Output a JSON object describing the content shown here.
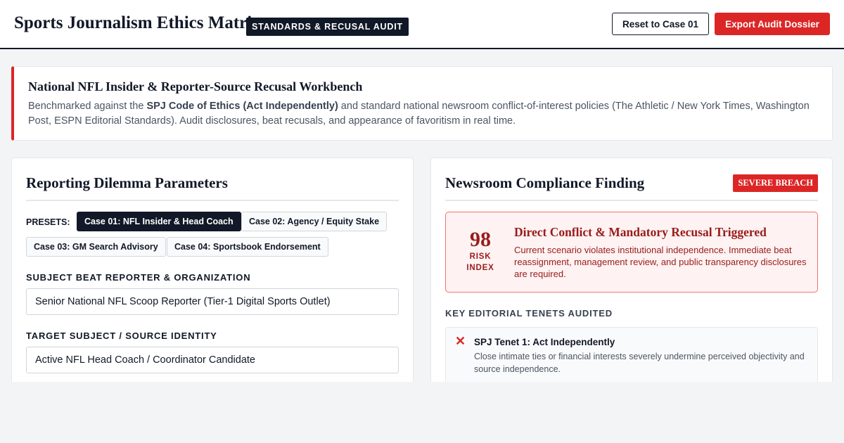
{
  "header": {
    "title": "Sports Journalism Ethics Matrix",
    "badge": "STANDARDS & RECUSAL AUDIT",
    "reset_label": "Reset to Case 01",
    "export_label": "Export Audit Dossier"
  },
  "notice": {
    "title": "National NFL Insider & Reporter-Source Recusal Workbench",
    "desc_prefix": "Benchmarked against the ",
    "desc_bold": "SPJ Code of Ethics (Act Independently)",
    "desc_suffix": " and standard national newsroom conflict-of-interest policies (The Athletic / New York Times, Washington Post, ESPN Editorial Standards). Audit disclosures, beat recusals, and appearance of favoritism in real time."
  },
  "parameters": {
    "title": "Reporting Dilemma Parameters",
    "presets_label": "PRESETS:",
    "presets": [
      {
        "label": "Case 01: NFL Insider & Head Coach",
        "active": true
      },
      {
        "label": "Case 02: Agency / Equity Stake",
        "active": false
      },
      {
        "label": "Case 03: GM Search Advisory",
        "active": false
      },
      {
        "label": "Case 04: Sportsbook Endorsement",
        "active": false
      }
    ],
    "reporter_label": "SUBJECT BEAT REPORTER & ORGANIZATION",
    "reporter_value": "Senior National NFL Scoop Reporter (Tier-1 Digital Sports Outlet)",
    "source_label": "TARGET SUBJECT / SOURCE IDENTITY",
    "source_value": "Active NFL Head Coach / Coordinator Candidate"
  },
  "finding": {
    "title": "Newsroom Compliance Finding",
    "badge": "SEVERE BREACH",
    "risk_value": "98",
    "risk_label": "RISK INDEX",
    "headline": "Direct Conflict & Mandatory Recusal Triggered",
    "description": "Current scenario violates institutional independence. Immediate beat reassignment, management review, and public transparency disclosures are required.",
    "tenets_label": "KEY EDITORIAL TENETS AUDITED",
    "tenets": [
      {
        "icon": "✕",
        "title": "SPJ Tenet 1: Act Independently",
        "description": "Close intimate ties or financial interests severely undermine perceived objectivity and source independence."
      }
    ]
  },
  "colors": {
    "accent": "#dc2626",
    "dark": "#111827",
    "danger_bg": "#fef2f2",
    "danger_text": "#991b1b"
  }
}
